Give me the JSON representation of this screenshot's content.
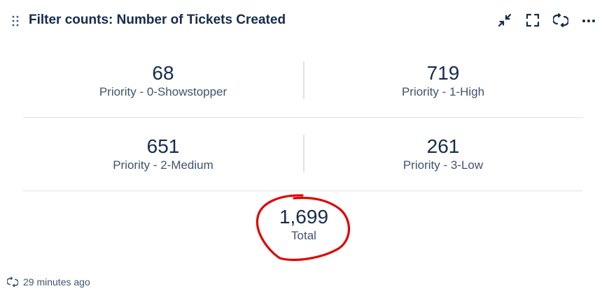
{
  "header": {
    "title": "Filter counts: Number of Tickets Created",
    "actions": [
      "collapse-icon",
      "fullscreen-icon",
      "refresh-icon",
      "more-icon"
    ]
  },
  "counts": [
    {
      "value": "68",
      "label": "Priority - 0-Showstopper"
    },
    {
      "value": "719",
      "label": "Priority - 1-High"
    },
    {
      "value": "651",
      "label": "Priority - 2-Medium"
    },
    {
      "value": "261",
      "label": "Priority - 3-Low"
    }
  ],
  "total": {
    "value": "1,699",
    "label": "Total"
  },
  "annotation": {
    "color": "#e00000"
  },
  "footer": {
    "updated": "29 minutes ago"
  },
  "colors": {
    "text": "#172b4d",
    "muted": "#42526e",
    "divider": "#dfe1e6"
  }
}
